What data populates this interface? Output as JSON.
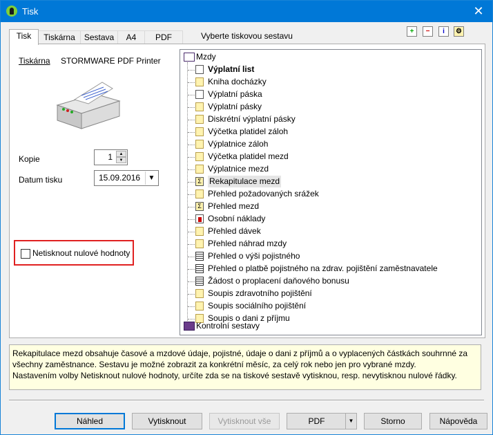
{
  "window": {
    "title": "Tisk"
  },
  "tabs": [
    "Tisk",
    "Tiskárna",
    "Sestava",
    "A4",
    "PDF"
  ],
  "hint": "Vyberte tiskovou sestavu",
  "printer": {
    "label": "Tiskárna",
    "name": "STORMWARE PDF Printer"
  },
  "copies": {
    "label": "Kopie",
    "value": "1"
  },
  "print_date": {
    "label": "Datum tisku",
    "value": "15.09.2016"
  },
  "zero_values_checkbox": {
    "label": "Netisknout nulové hodnoty",
    "checked": false
  },
  "tree": {
    "root": "Mzdy",
    "items": [
      {
        "label": "Výplatní list",
        "icon": "page-icon",
        "bold": true
      },
      {
        "label": "Kniha docházky",
        "icon": "folder-icon"
      },
      {
        "label": "Výplatní páska",
        "icon": "page-icon"
      },
      {
        "label": "Výplatní pásky",
        "icon": "folder-icon"
      },
      {
        "label": "Diskrétní výplatní pásky",
        "icon": "folder-icon"
      },
      {
        "label": "Výčetka platidel záloh",
        "icon": "folder-icon"
      },
      {
        "label": "Výplatnice záloh",
        "icon": "folder-icon"
      },
      {
        "label": "Výčetka platidel mezd",
        "icon": "folder-icon"
      },
      {
        "label": "Výplatnice mezd",
        "icon": "folder-icon"
      },
      {
        "label": "Rekapitulace mezd",
        "icon": "sigma-icon",
        "selected": true
      },
      {
        "label": "Přehled požadovaných srážek",
        "icon": "folder-icon"
      },
      {
        "label": "Přehled mezd",
        "icon": "sigma-icon"
      },
      {
        "label": "Osobní náklady",
        "icon": "bar-chart-icon"
      },
      {
        "label": "Přehled dávek",
        "icon": "folder-icon"
      },
      {
        "label": "Přehled náhrad mzdy",
        "icon": "folder-icon"
      },
      {
        "label": "Přehled o výši pojistného",
        "icon": "document-icon"
      },
      {
        "label": "Přehled o platbě pojistného na zdrav. pojištění zaměstnavatele",
        "icon": "document-icon"
      },
      {
        "label": "Žádost o proplacení daňového bonusu",
        "icon": "document-icon"
      },
      {
        "label": "Soupis zdravotního pojištění",
        "icon": "folder-icon"
      },
      {
        "label": "Soupis sociálního pojištění",
        "icon": "folder-icon"
      },
      {
        "label": "Soupis o dani z příjmu",
        "icon": "folder-icon"
      }
    ],
    "root2": "Kontrolní sestavy"
  },
  "description": [
    "Rekapitulace mezd obsahuje časové a mzdové údaje, pojistné, údaje o dani z příjmů a o vyplacených částkách souhrnné za všechny zaměstnance. Sestavu je možné zobrazit za konkrétní měsíc, za celý rok nebo jen pro vybrané mzdy.",
    "Nastavením volby Netisknout nulové hodnoty, určíte zda se na tiskové sestavě vytisknou, resp. nevytisknou nulové řádky."
  ],
  "buttons": {
    "preview": "Náhled",
    "print": "Vytisknout",
    "print_all": "Vytisknout vše",
    "pdf": "PDF",
    "cancel": "Storno",
    "help": "Nápověda"
  },
  "colors": {
    "titlebar": "#0078d7",
    "highlight": "#e02020",
    "description_bg": "#ffffe1"
  }
}
